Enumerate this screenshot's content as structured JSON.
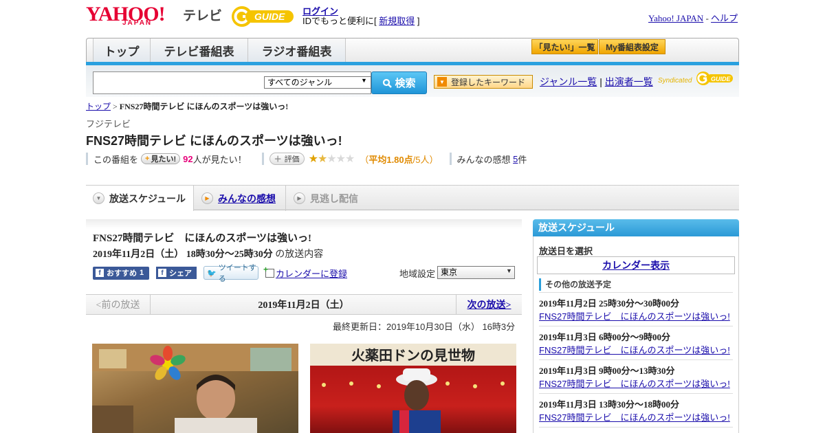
{
  "header": {
    "yahoo_logo": "YAHOO!",
    "yahoo_japan": "JAPAN",
    "tv_label": "テレビ",
    "gguide_logo": "G-GUIDE",
    "login": "ログイン",
    "login_desc_prefix": "IDでもっと便利に[",
    "register": "新規取得",
    "login_desc_suffix": "]",
    "yahoo_japan_link": "Yahoo! JAPAN",
    "separator": "-",
    "help": "ヘルプ"
  },
  "nav": {
    "tabs": [
      {
        "label": "トップ"
      },
      {
        "label": "テレビ番組表"
      },
      {
        "label": "ラジオ番組表"
      }
    ],
    "mitai_list": "「見たい!」一覧",
    "my_listing": "My番組表設定"
  },
  "search": {
    "genre_value": "すべてのジャンル",
    "search_button": "検索",
    "keyword_button": "登録したキーワード",
    "genre_list": "ジャンル一覧",
    "divider": "|",
    "performer_list": "出演者一覧",
    "syndicated": "Syndicated"
  },
  "breadcrumb": {
    "top": "トップ",
    "sep": ">",
    "current": "FNS27時間テレビ にほんのスポーツは強いっ!"
  },
  "program": {
    "station": "フジテレビ",
    "title": "FNS27時間テレビ にほんのスポーツは強いっ!",
    "watch_prefix": "この番組を",
    "mitai_button": "見たい!",
    "watch_count": "92",
    "watch_suffix": "人が見たい！",
    "rate_button": "評価",
    "rating_open": "（",
    "rating_avg": "平均1.80点",
    "rating_count": "/5人）",
    "rating_value": 1.8,
    "impressions_label": "みんなの感想",
    "impressions_count": "5",
    "impressions_unit": "件"
  },
  "tabs": [
    {
      "label": "放送スケジュール"
    },
    {
      "label": "みんなの感想"
    },
    {
      "label": "見逃し配信"
    }
  ],
  "main": {
    "title": "FNS27時間テレビ　にほんのスポーツは強いっ!",
    "date": "2019年11月2日（土）  18時30分～25時30分",
    "date_suffix": " の放送内容",
    "fb_recommend": "おすすめ",
    "fb_count": "1",
    "fb_share": "シェア",
    "tweet": "ツイートする",
    "calendar_register": "カレンダーに登録",
    "region_label": "地域設定",
    "region_value": "東京",
    "prev": "<前の放送",
    "current_date": "2019年11月2日（土）",
    "next": "次の放送>",
    "updated": "最終更新日：2019年10月30日（水）  16時3分"
  },
  "sidebar": {
    "title": "放送スケジュール",
    "select_date": "放送日を選択",
    "calendar_view": "カレンダー表示",
    "other_schedule": "その他の放送予定",
    "items": [
      {
        "when": "2019年11月2日  25時30分～30時00分",
        "what": "FNS27時間テレビ　にほんのスポーツは強いっ!"
      },
      {
        "when": "2019年11月3日  6時00分～9時00分",
        "what": "FNS27時間テレビ　にほんのスポーツは強いっ!"
      },
      {
        "when": "2019年11月3日  9時00分～13時30分",
        "what": "FNS27時間テレビ　にほんのスポーツは強いっ!"
      },
      {
        "when": "2019年11月3日  13時30分～18時00分",
        "what": "FNS27時間テレビ　にほんのスポーツは強いっ!"
      }
    ]
  },
  "colors": {
    "accent_blue": "#2aa0df",
    "yahoo_red": "#e60033",
    "gguide_yellow": "#f5c400",
    "rating_orange": "#e08a00",
    "watch_pink": "#e6007a"
  }
}
